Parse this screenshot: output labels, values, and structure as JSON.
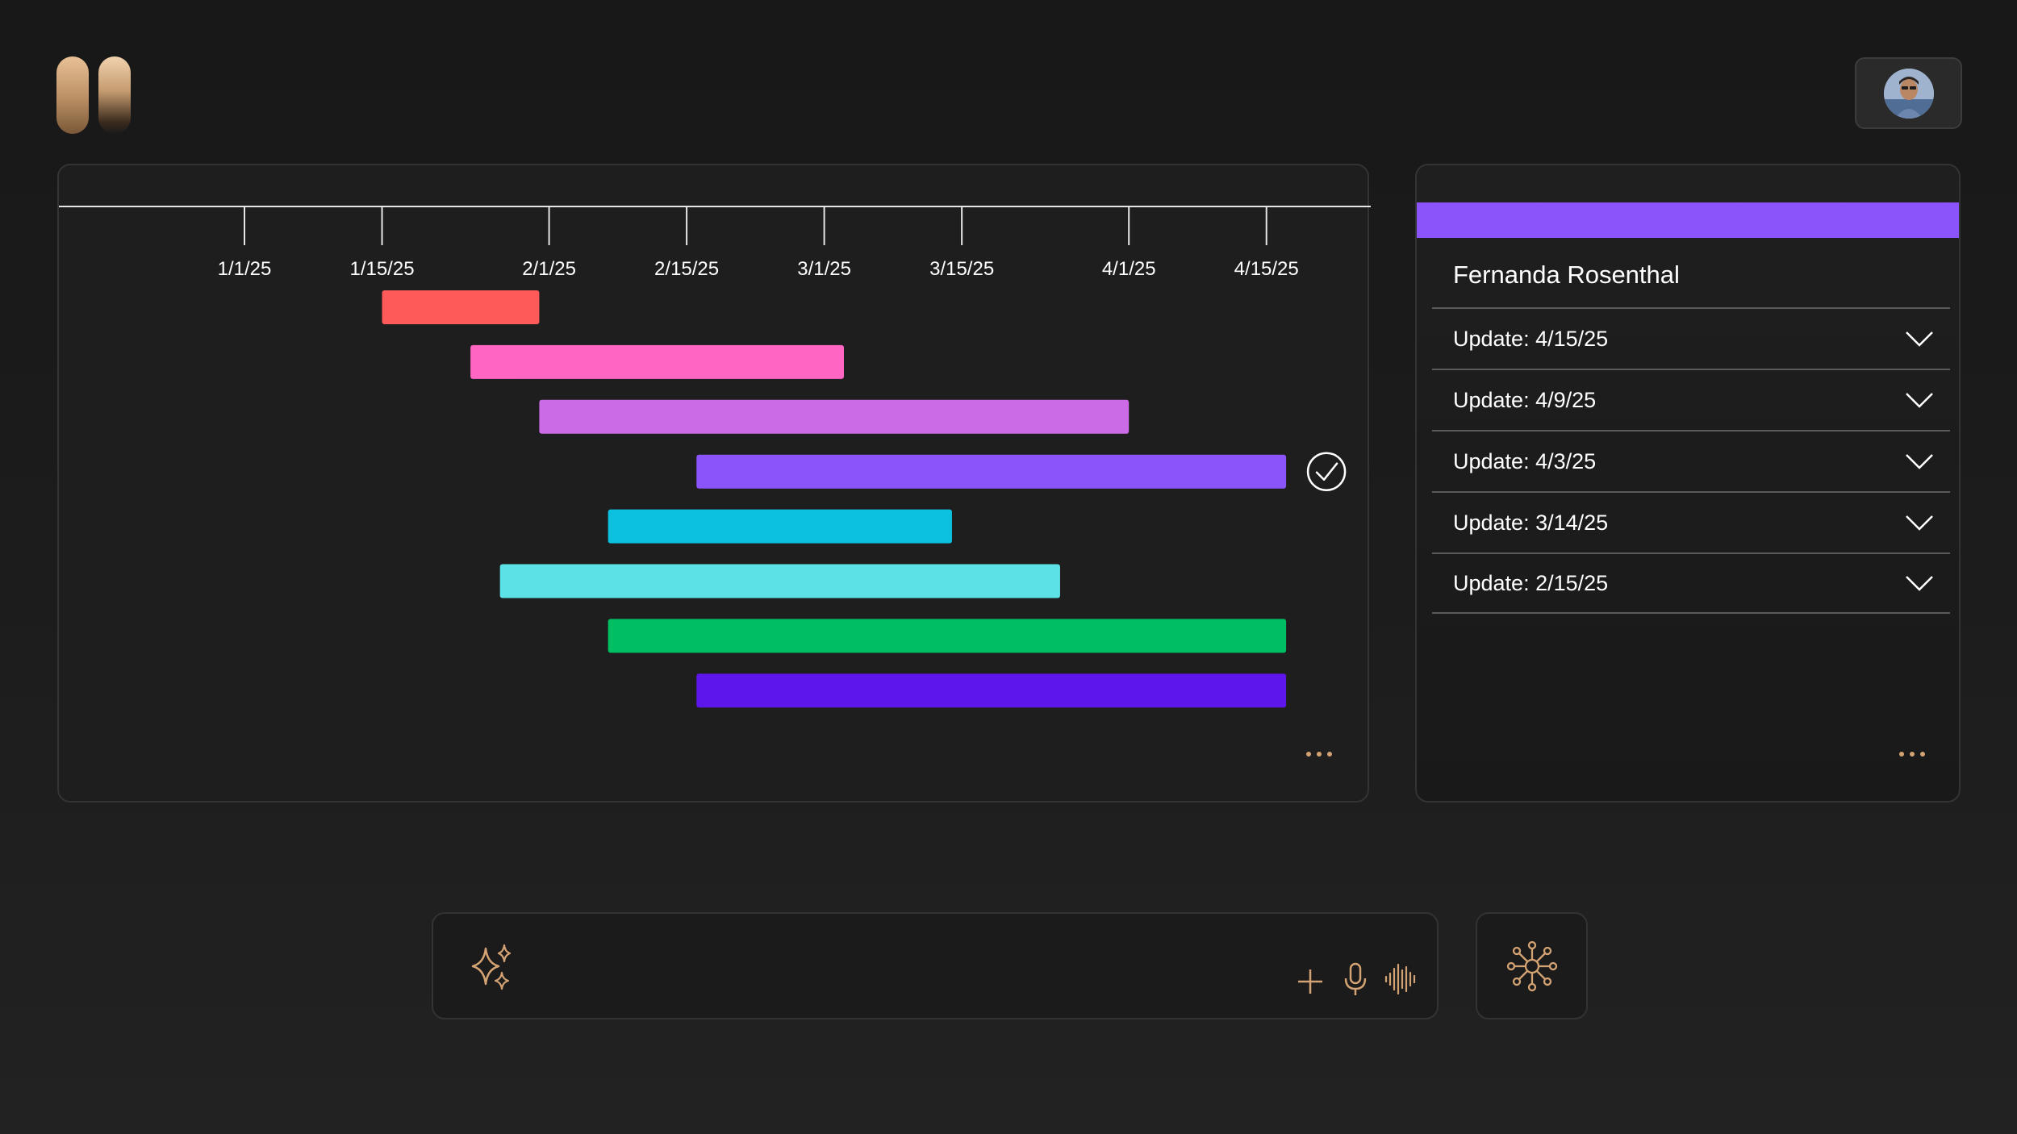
{
  "app": {
    "logo_icon": "brand-logo-icon",
    "accent_color": "#d4a373"
  },
  "user": {
    "avatar_icon": "user-avatar"
  },
  "chart_data": {
    "type": "gantt",
    "x_axis_type": "date",
    "tick_labels": [
      "1/1/25",
      "1/15/25",
      "2/1/25",
      "2/15/25",
      "3/1/25",
      "3/15/25",
      "4/1/25",
      "4/15/25"
    ],
    "ticks": [
      "2025-01-01",
      "2025-01-15",
      "2025-02-01",
      "2025-02-15",
      "2025-03-01",
      "2025-03-15",
      "2025-04-01",
      "2025-04-15"
    ],
    "tasks": [
      {
        "start": "2025-01-15",
        "end": "2025-01-31",
        "color": "#ff5a5a"
      },
      {
        "start": "2025-01-24",
        "end": "2025-03-03",
        "color": "#ff66c4"
      },
      {
        "start": "2025-01-31",
        "end": "2025-04-01",
        "color": "#cb6ce6"
      },
      {
        "start": "2025-02-16",
        "end": "2025-04-17",
        "color": "#8b54fa",
        "completed": true
      },
      {
        "start": "2025-02-07",
        "end": "2025-03-14",
        "color": "#0cc0df"
      },
      {
        "start": "2025-01-27",
        "end": "2025-03-25",
        "color": "#5ce1e6"
      },
      {
        "start": "2025-02-07",
        "end": "2025-04-17",
        "color": "#00bf63"
      },
      {
        "start": "2025-02-16",
        "end": "2025-04-17",
        "color": "#5e17eb"
      }
    ],
    "grid": false
  },
  "updates": {
    "header_color": "#8b54fa",
    "name": "Fernanda Rosenthal",
    "items": [
      {
        "label": "Update: 4/15/25"
      },
      {
        "label": "Update: 4/9/25"
      },
      {
        "label": "Update: 4/3/25"
      },
      {
        "label": "Update: 3/14/25"
      },
      {
        "label": "Update: 2/15/25"
      }
    ]
  },
  "prompt": {
    "value": "",
    "placeholder": "",
    "sparkle_icon": "sparkle-icon",
    "add_icon": "plus-icon",
    "mic_icon": "microphone-icon",
    "voice_icon": "waveform-icon"
  },
  "hub": {
    "icon": "network-hub-icon"
  }
}
